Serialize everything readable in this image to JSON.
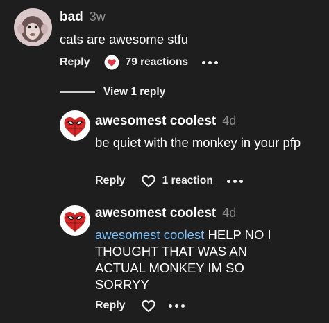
{
  "comments": [
    {
      "author": "bad",
      "time": "3w",
      "text": "cats are awesome stfu",
      "reply_label": "Reply",
      "reactions": "79 reactions"
    }
  ],
  "thread": {
    "view_replies": "View 1 reply"
  },
  "replies": [
    {
      "author": "awesomest coolest",
      "time": "4d",
      "text": "be quiet with the monkey in your pfp",
      "reply_label": "Reply",
      "reactions": "1 reaction"
    },
    {
      "author": "awesomest coolest",
      "time": "4d",
      "mention": "awesomest coolest",
      "text": " HELP NO I THOUGHT THAT WAS AN ACTUAL MONKEY IM SO SORRYY",
      "reply_label": "Reply"
    }
  ],
  "colors": {
    "background": "#1e1e1e",
    "mention": "#7cc4ff",
    "heart_red": "#e0384b"
  },
  "icons": {
    "reaction": "heart-emoji-icon",
    "react_outline": "heart-outline-icon",
    "more": "more-options-icon"
  }
}
